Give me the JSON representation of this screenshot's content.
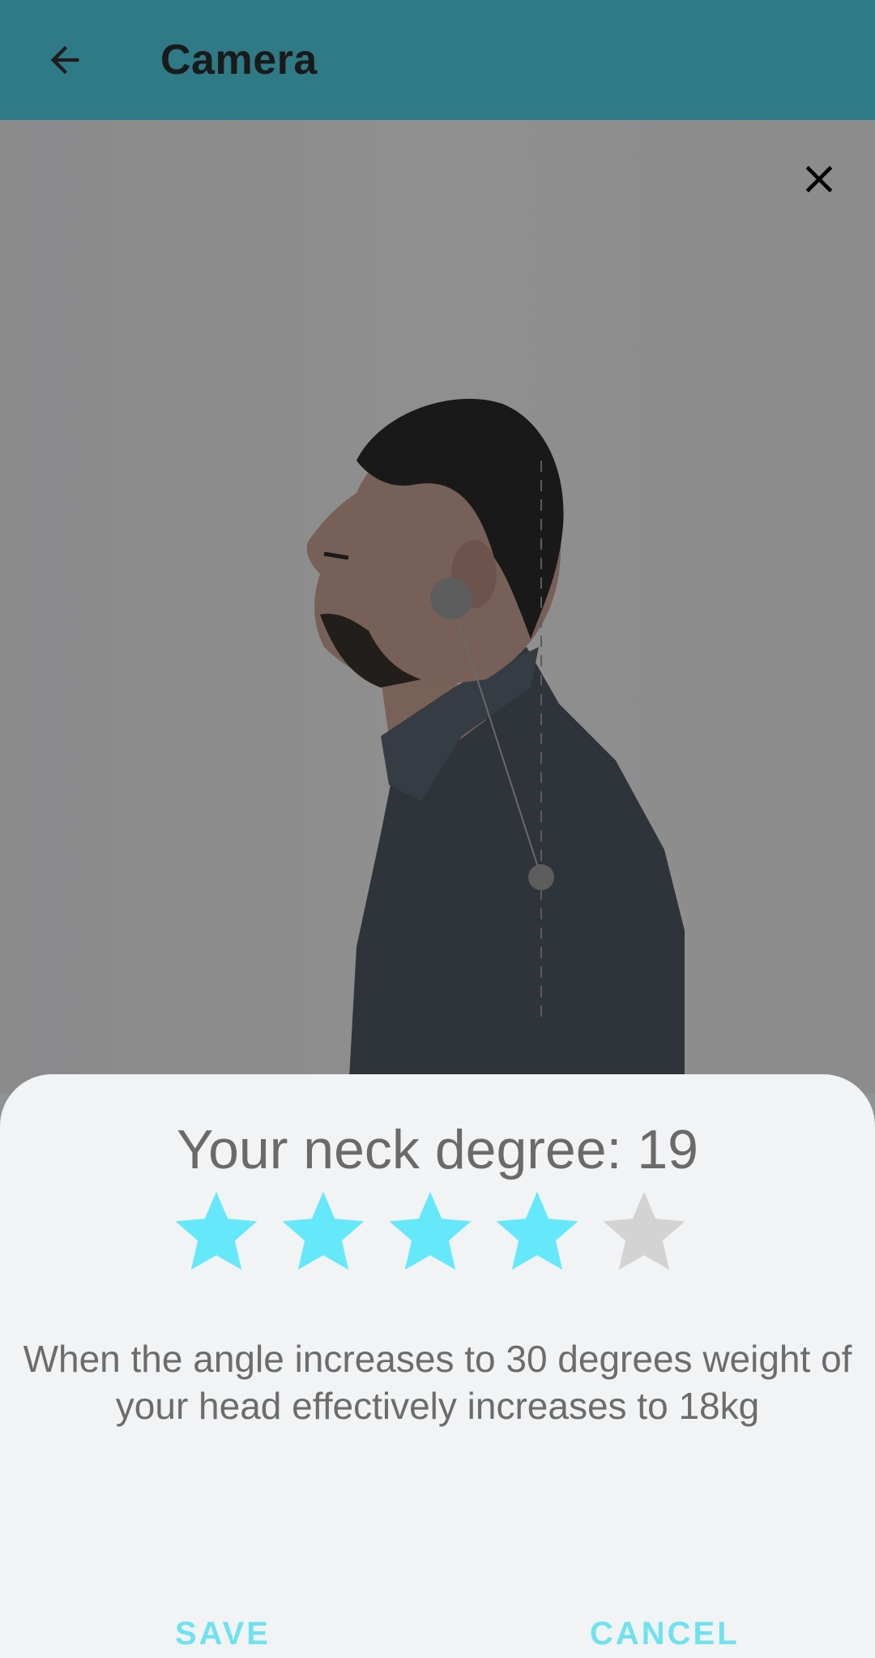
{
  "app_bar": {
    "title": "Camera",
    "back_icon": "arrow-left-icon",
    "background_color": "#2e7a86"
  },
  "photo": {
    "description_icon": "person-profile-photo",
    "close_icon": "close-icon"
  },
  "result_sheet": {
    "degree_text": "Your neck degree: 19",
    "rating": 4,
    "rating_max": 5,
    "star_filled_color": "#66e8fb",
    "star_empty_color": "#d3d3d3",
    "description": "When the angle increases to 30 degrees weight of your head effectively increases to 18kg",
    "save_label": "SAVE",
    "cancel_label": "CANCEL"
  }
}
